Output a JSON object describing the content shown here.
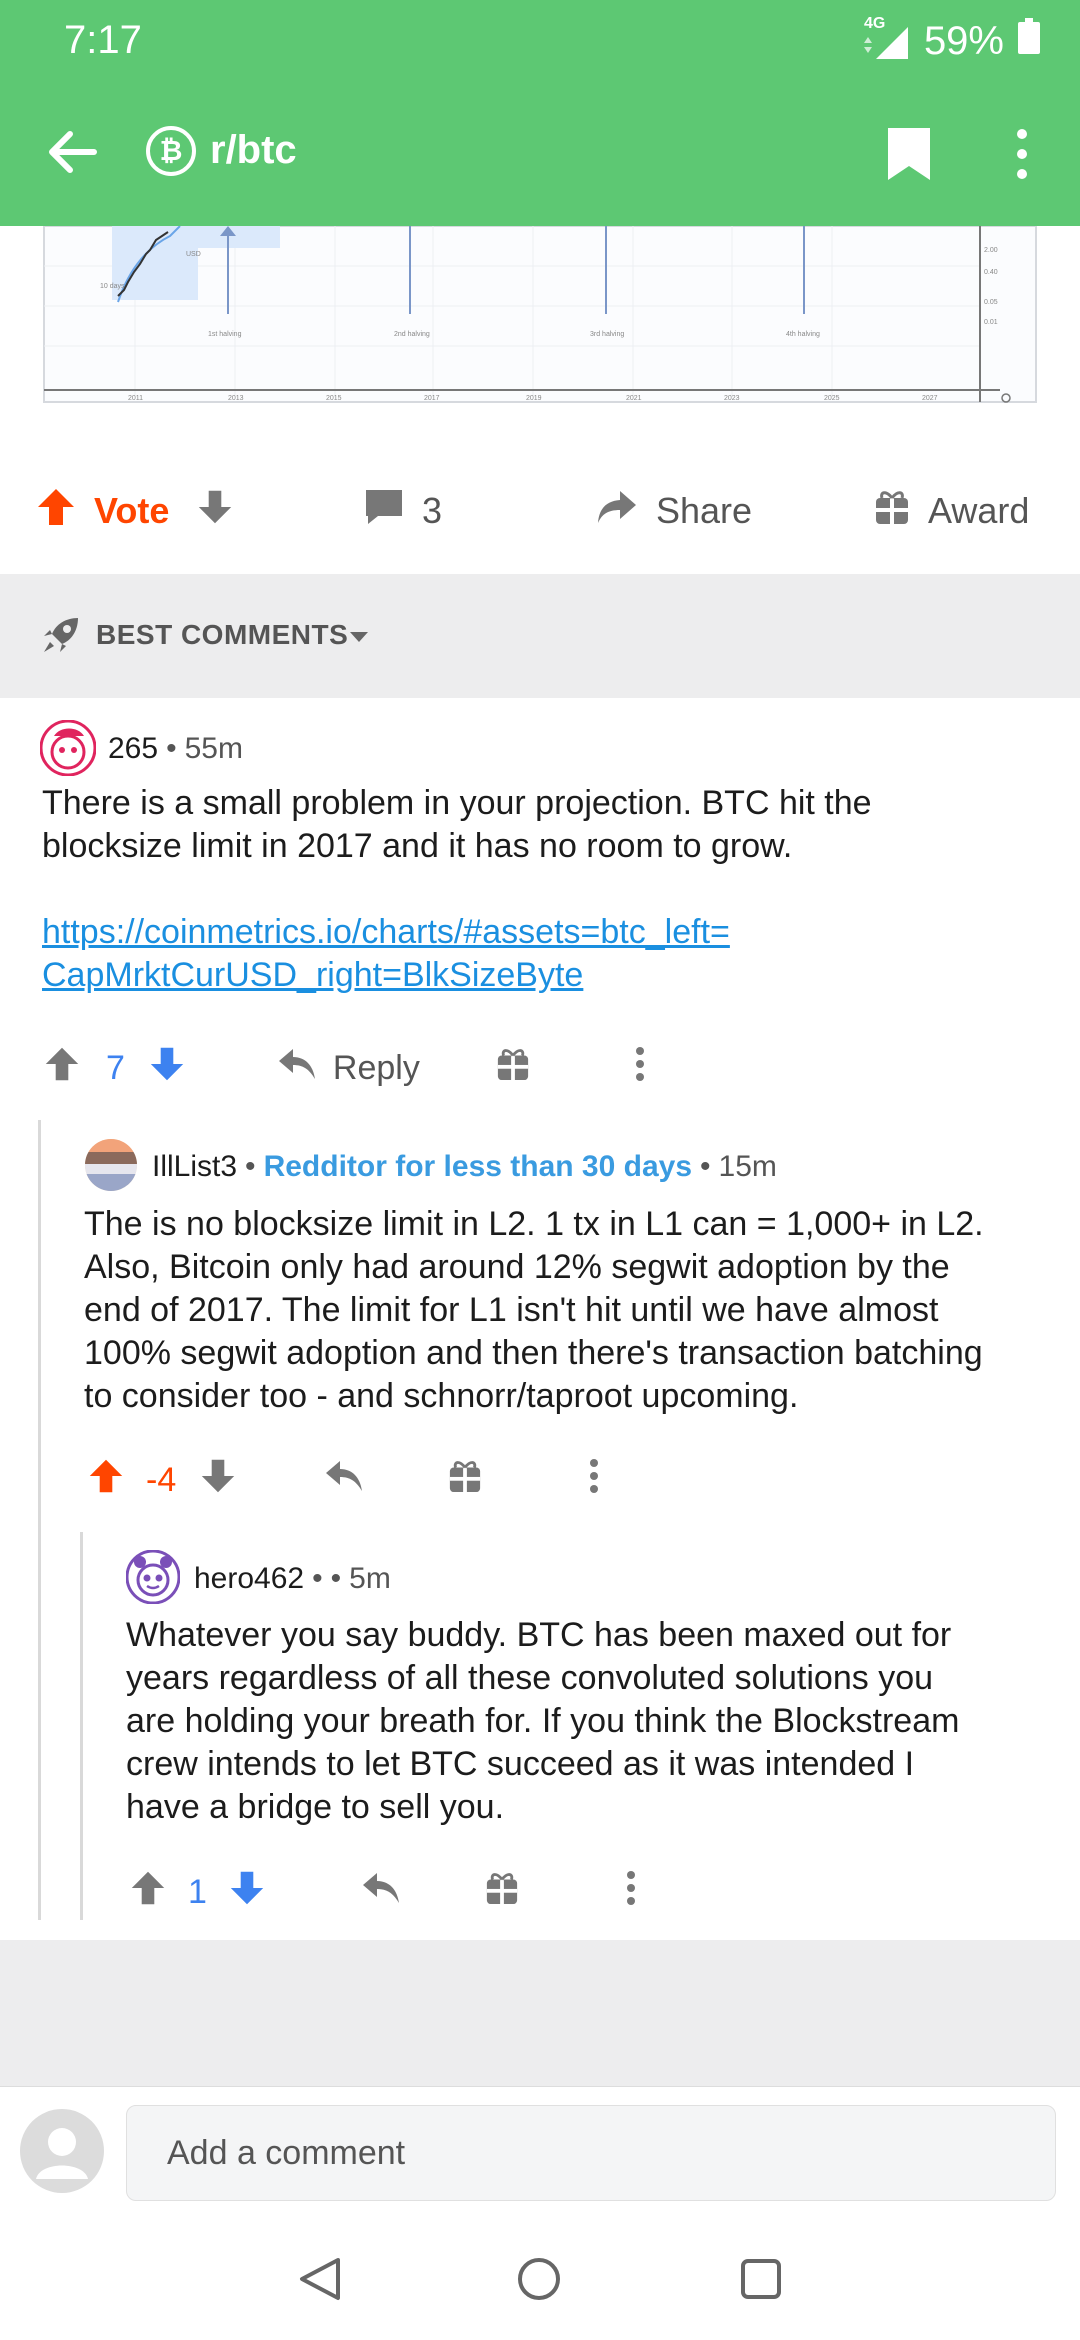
{
  "status": {
    "time": "7:17",
    "network": "4G",
    "battery": "59%"
  },
  "header": {
    "subreddit": "r/btc",
    "sub_icon_glyph": "₿",
    "colors": {
      "bar": "#5dc873"
    }
  },
  "chart_image": {
    "xticks": [
      "2011",
      "2013",
      "2015",
      "2017",
      "2019",
      "2021",
      "2023",
      "2025",
      "2027"
    ],
    "yticks": [
      "2.00",
      "0.40",
      "0.05",
      "0.01"
    ],
    "halvings": [
      "1st halving",
      "2nd halving",
      "3rd halving",
      "4th halving"
    ],
    "inset": "USD",
    "subtext": "10 days"
  },
  "actions": {
    "vote": "Vote",
    "comments": "3",
    "share": "Share",
    "award": "Award"
  },
  "sort": {
    "label": "BEST COMMENTS"
  },
  "comments": [
    {
      "author": "265",
      "sep": "•",
      "age": "55m",
      "line1": "There is a small problem in your projection. BTC hit the",
      "line2": "blocksize limit in 2017 and it has no room to grow.",
      "link1": "https://coinmetrics.io/charts/#assets=btc_left=",
      "link2": "CapMrktCurUSD_right=BlkSizeByte",
      "score": "7",
      "reply": "Reply"
    },
    {
      "author": "IllList3",
      "sep": "•",
      "flair": "Redditor for less than 30 days",
      "sep2": "•",
      "age": "15m",
      "lines": [
        "The is no blocksize limit in L2.  1 tx in L1 can = 1,000+ in L2.",
        "Also, Bitcoin only had around 12% segwit adoption by the",
        "end of 2017.  The limit for L1 isn't hit until we have almost",
        "100% segwit adoption and then there's transaction batching",
        "to consider too - and schnorr/taproot upcoming."
      ],
      "score": "-4"
    },
    {
      "author": "hero462",
      "sep": "•",
      "sep2": "•",
      "age": "5m",
      "lines": [
        "Whatever you say buddy.  BTC has been maxed out for",
        "years regardless of all these convoluted solutions you",
        "are holding your breath for.  If you think the Blockstream",
        "crew intends to let BTC succeed as it was intended I",
        "have a bridge to sell you."
      ],
      "score": "1"
    }
  ],
  "composer": {
    "placeholder": "Add a comment"
  },
  "colors": {
    "upvote": "#ff4500",
    "downvote": "#3d82f0",
    "link": "#1a8fe0",
    "flair": "#3a9be0"
  }
}
